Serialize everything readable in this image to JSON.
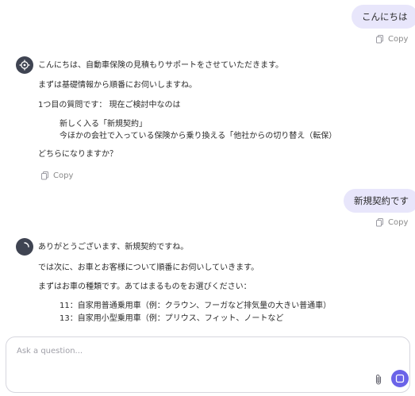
{
  "conversation": {
    "user_message_1": "こんにちは",
    "copy_label": "Copy",
    "assistant_message_1": {
      "line_1": "こんにちは、自動車保険の見積もりサポートをさせていただきます。",
      "line_2": "まずは基礎情報から順番にお伺いしますね。",
      "line_3": "1つ目の質問です： 現在ご検討中なのは",
      "option_1": "新しく入る「新規契約」",
      "option_2": "今ほかの会社で入っている保険から乗り換える「他社からの切り替え（転保）",
      "line_4": "どちらになりますか？"
    },
    "user_message_2": "新規契約です",
    "assistant_message_2": {
      "line_1": "ありがとうございます、新規契約ですね。",
      "line_2": "では次に、お車とお客様について順番にお伺いしていきます。",
      "line_3": "まずはお車の種類です。あてはまるものをお選びください：",
      "option_1": "11：自家用普通乗用車（例：クラウン、フーガなど排気量の大きい普通車）",
      "option_2": "13：自家用小型乗用車（例：プリウス、フィット、ノートなど"
    }
  },
  "composer": {
    "placeholder": "Ask a question..."
  },
  "icons": {
    "copy": "copy-icon",
    "assistant_avatar": "target-icon",
    "assistant_avatar_loading": "spinner-icon",
    "attach": "paperclip-icon",
    "send": "stop-icon"
  },
  "colors": {
    "accent": "#6b63e8",
    "user_bubble": "#e8e6fb",
    "avatar": "#3f4452"
  }
}
